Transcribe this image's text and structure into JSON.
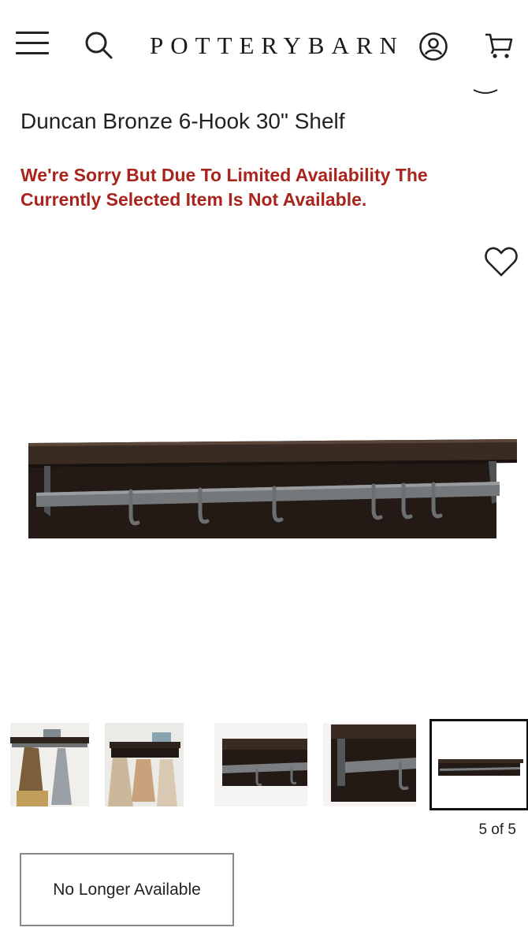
{
  "header": {
    "logo_text": "POTTERYBARN",
    "icons": [
      "menu-icon",
      "search-icon",
      "account-icon",
      "cart-icon"
    ]
  },
  "product": {
    "title": "Duncan Bronze 6-Hook 30\" Shelf",
    "availability_notice": "We're Sorry But Due To Limited Availability The Currently Selected Item Is Not Available."
  },
  "gallery": {
    "counter": "5 of 5",
    "current_index": 5,
    "total": 5
  },
  "actions": {
    "unavailable_button": "No Longer Available"
  },
  "colors": {
    "notice_red": "#a8241c",
    "text": "#222222",
    "wood_dark": "#2b2019",
    "metal": "#6f7275"
  }
}
